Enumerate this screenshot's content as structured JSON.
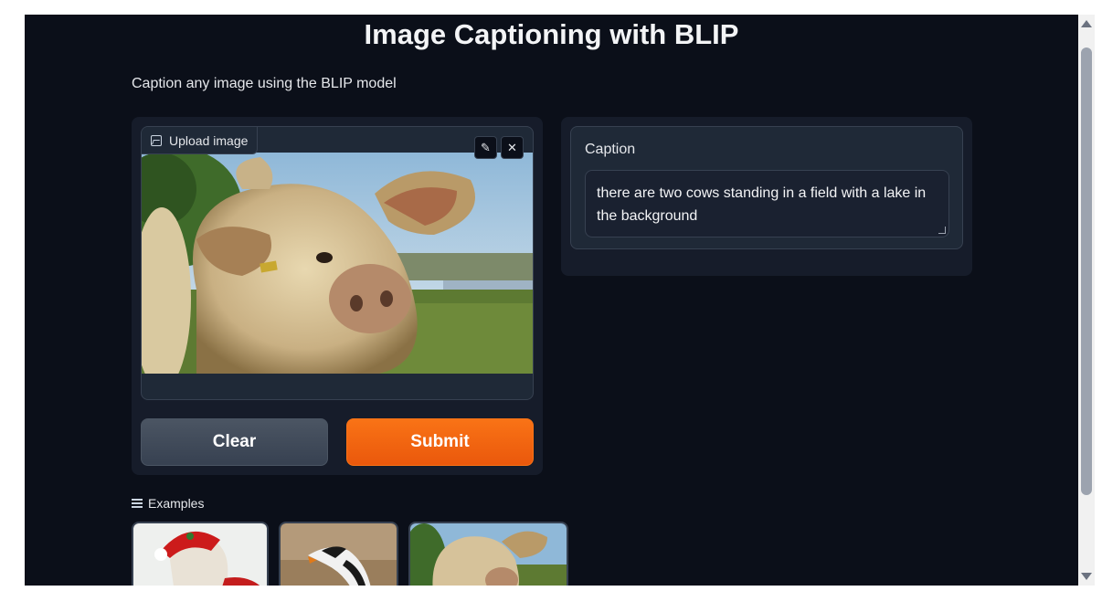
{
  "app": {
    "title": "Image Captioning with BLIP",
    "description": "Caption any image using the BLIP model"
  },
  "input": {
    "upload_label": "Upload image",
    "edit_icon": "pencil-icon",
    "close_icon": "close-icon",
    "image_subject": "cow"
  },
  "buttons": {
    "clear_label": "Clear",
    "submit_label": "Submit"
  },
  "output": {
    "caption_label": "Caption",
    "caption_value": "there are two cows standing in a field with a lake in the background"
  },
  "examples": {
    "label": "Examples",
    "items": [
      "dog-in-santa-hat",
      "bird",
      "cow"
    ]
  },
  "colors": {
    "background": "#0b0f19",
    "panel": "#161c2a",
    "accent": "#f97316",
    "neutral_button": "#4b5563"
  }
}
